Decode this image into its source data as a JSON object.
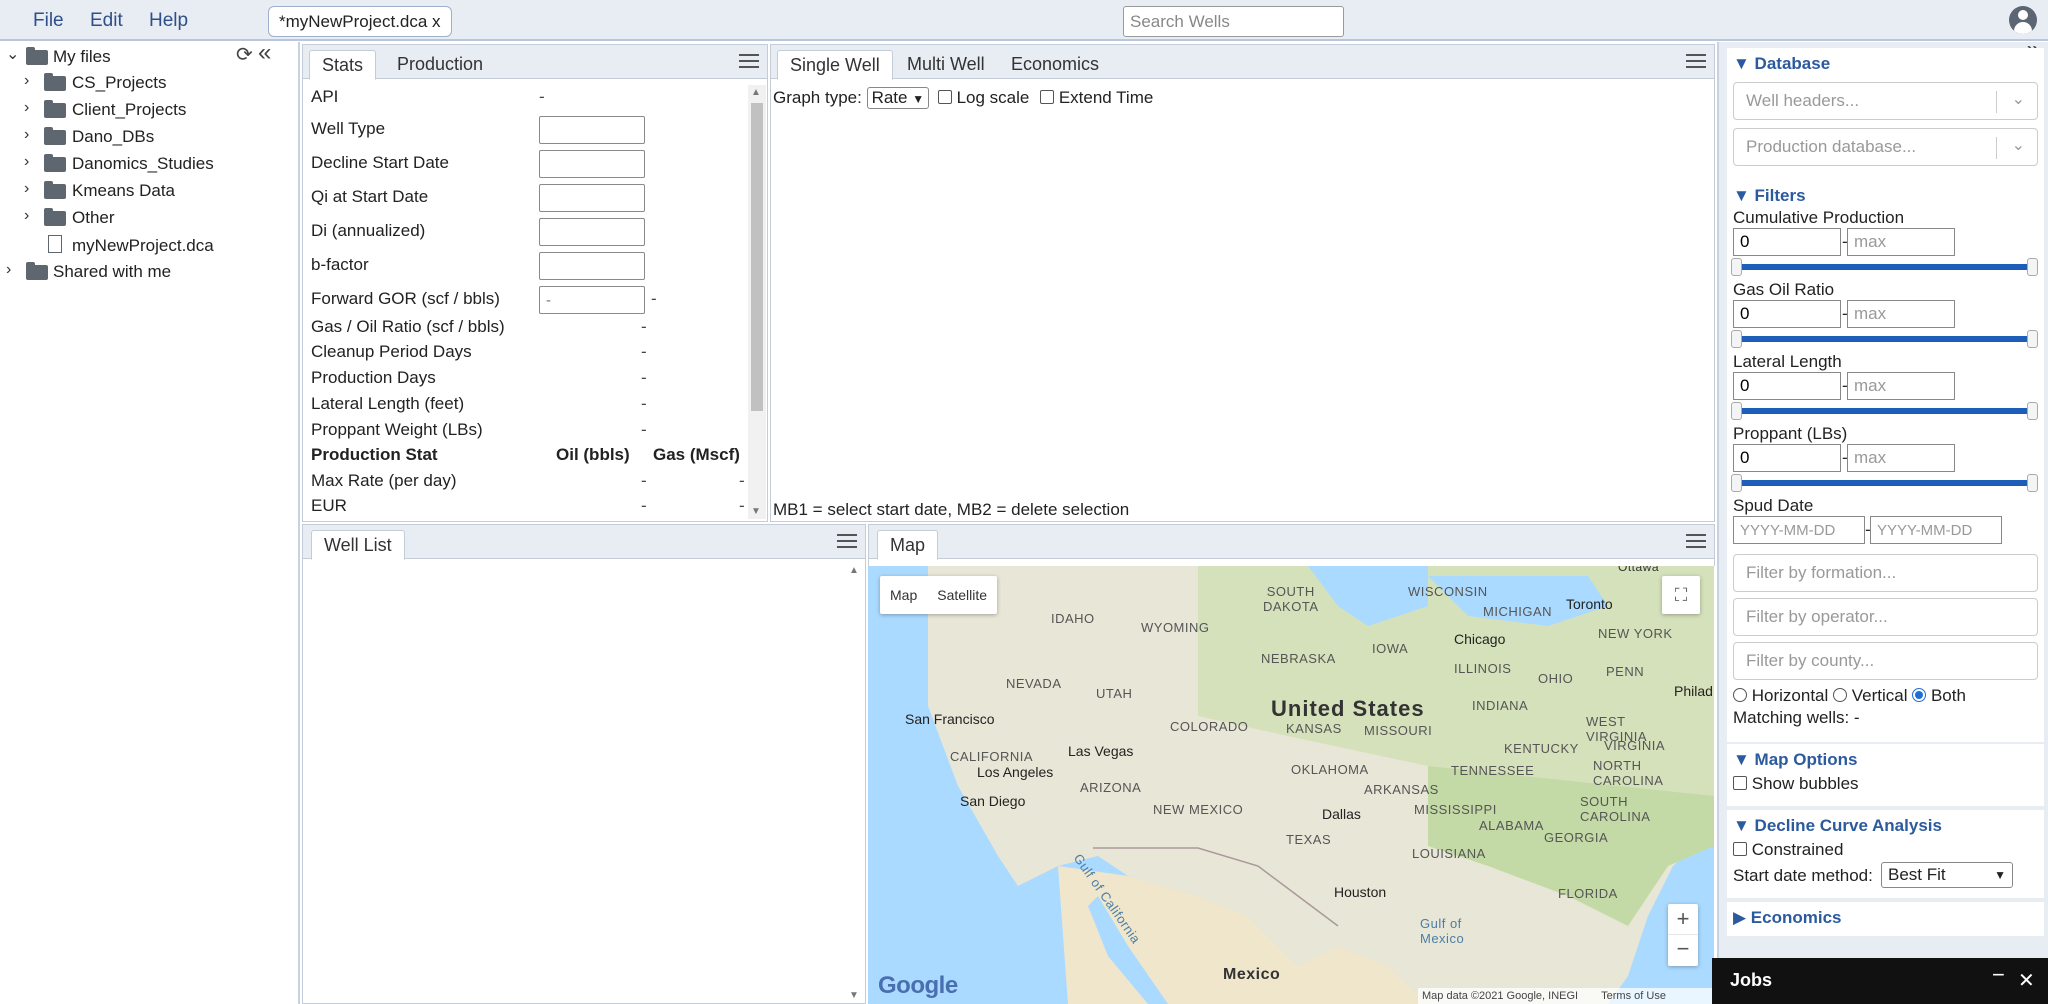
{
  "menu": {
    "file": "File",
    "edit": "Edit",
    "help": "Help"
  },
  "open_tab": "*myNewProject.dca x",
  "search": {
    "placeholder": "Search Wells"
  },
  "filetree": {
    "items": [
      {
        "label": "My files",
        "type": "folder",
        "expanded": true
      },
      {
        "label": "CS_Projects",
        "type": "folder"
      },
      {
        "label": "Client_Projects",
        "type": "folder"
      },
      {
        "label": "Dano_DBs",
        "type": "folder"
      },
      {
        "label": "Danomics_Studies",
        "type": "folder"
      },
      {
        "label": "Kmeans Data",
        "type": "folder"
      },
      {
        "label": "Other",
        "type": "folder"
      },
      {
        "label": "myNewProject.dca",
        "type": "file"
      },
      {
        "label": "Shared with me",
        "type": "folder"
      }
    ]
  },
  "stats_panel": {
    "tabs": [
      "Stats",
      "Production"
    ],
    "rows": [
      {
        "label": "API",
        "value": "-"
      },
      {
        "label": "Well Type",
        "input": ""
      },
      {
        "label": "Decline Start Date",
        "input": ""
      },
      {
        "label": "Qi at Start Date",
        "input": ""
      },
      {
        "label": "Di (annualized)",
        "input": ""
      },
      {
        "label": "b-factor",
        "input": ""
      },
      {
        "label": "Forward GOR (scf / bbls)",
        "input_placeholder": "-",
        "value": "-"
      },
      {
        "label": "Gas / Oil Ratio (scf / bbls)",
        "value": "-"
      },
      {
        "label": "Cleanup Period Days",
        "value": "-"
      },
      {
        "label": "Production Days",
        "value": "-"
      },
      {
        "label": "Lateral Length (feet)",
        "value": "-"
      },
      {
        "label": "Proppant Weight (LBs)",
        "value": "-"
      }
    ],
    "prod_header": {
      "label": "Production Stat",
      "oil": "Oil (bbls)",
      "gas": "Gas (Mscf)"
    },
    "prod_rows": [
      {
        "label": "Max Rate (per day)",
        "oil": "-",
        "gas": "-"
      },
      {
        "label": "EUR",
        "oil": "-",
        "gas": "-"
      }
    ]
  },
  "graph_panel": {
    "tabs": [
      "Single Well",
      "Multi Well",
      "Economics"
    ],
    "graph_type_label": "Graph type:",
    "graph_type_value": "Rate",
    "log_scale_label": "Log scale",
    "extend_time_label": "Extend Time",
    "hint": "MB1 = select start date, MB2 = delete selection"
  },
  "well_list_panel": {
    "tab": "Well List"
  },
  "map_panel": {
    "tab": "Map",
    "map_type_buttons": [
      "Map",
      "Satellite"
    ],
    "zoom_in": "+",
    "zoom_out": "−",
    "google": "Google",
    "attribution": "Map data ©2021 Google, INEGI",
    "terms": "Terms of Use",
    "country_label": "United States",
    "region_labels": {
      "south_dakota": "SOUTH\nDAKOTA",
      "wisconsin": "WISCONSIN",
      "michigan": "MICHIGAN",
      "idaho": "IDAHO",
      "wyoming": "WYOMING",
      "nebraska": "NEBRASKA",
      "iowa": "IOWA",
      "new_york": "NEW YORK",
      "illinois": "ILLINOIS",
      "ohio": "OHIO",
      "penn": "PENN",
      "nevada": "NEVADA",
      "utah": "UTAH",
      "colorado": "COLORADO",
      "kansas": "KANSAS",
      "missouri": "MISSOURI",
      "indiana": "INDIANA",
      "west_virginia": "WEST\nVIRGINIA",
      "virginia": "VIRGINIA",
      "kentucky": "KENTUCKY",
      "california": "CALIFORNIA",
      "arizona": "ARIZONA",
      "new_mexico": "NEW MEXICO",
      "oklahoma": "OKLAHOMA",
      "tennessee": "TENNESSEE",
      "north_carolina": "NORTH\nCAROLINA",
      "arkansas": "ARKANSAS",
      "south_carolina": "SOUTH\nCAROLINA",
      "mississippi": "MISSISSIPPI",
      "alabama": "ALABAMA",
      "georgia": "GEORGIA",
      "texas": "TEXAS",
      "louisiana": "LOUISIANA",
      "florida": "FLORIDA",
      "gulf_california": "Gulf of California",
      "gulf_mexico": "Gulf of\nMexico",
      "mexico": "Mexico",
      "ottawa": "Ottawa"
    },
    "cities": {
      "toronto": "Toronto",
      "chicago": "Chicago",
      "philadelphia": "Philad",
      "san_francisco": "San Francisco",
      "las_vegas": "Las Vegas",
      "los_angeles": "Los Angeles",
      "san_diego": "San Diego",
      "dallas": "Dallas",
      "houston": "Houston"
    }
  },
  "sidebar": {
    "database": {
      "title": "▼ Database",
      "well_headers_placeholder": "Well headers...",
      "production_placeholder": "Production database..."
    },
    "filters": {
      "title": "▼ Filters",
      "ranges": [
        {
          "label": "Cumulative Production",
          "min": "0",
          "max_placeholder": "max"
        },
        {
          "label": "Gas Oil Ratio",
          "min": "0",
          "max_placeholder": "max"
        },
        {
          "label": "Lateral Length",
          "min": "0",
          "max_placeholder": "max"
        },
        {
          "label": "Proppant (LBs)",
          "min": "0",
          "max_placeholder": "max"
        }
      ],
      "spud_label": "Spud Date",
      "spud_from_placeholder": "YYYY-MM-DD",
      "spud_to_placeholder": "YYYY-MM-DD",
      "formation_placeholder": "Filter by formation...",
      "operator_placeholder": "Filter by operator...",
      "county_placeholder": "Filter by county...",
      "orientation": {
        "horizontal": "Horizontal",
        "vertical": "Vertical",
        "both": "Both",
        "selected": "Both"
      },
      "matching": "Matching wells: -"
    },
    "map_options": {
      "title": "▼ Map Options",
      "show_bubbles": "Show bubbles"
    },
    "dca": {
      "title": "▼ Decline Curve Analysis",
      "constrained": "Constrained",
      "start_method_label": "Start date method:",
      "start_method_value": "Best Fit"
    },
    "economics": {
      "title": "▶ Economics"
    }
  },
  "jobs": {
    "title": "Jobs",
    "minimize": "−",
    "close": "✕"
  },
  "colors": {
    "accent": "#2b5a9e",
    "slider": "#1d5fb8",
    "topbar": "#e8ecf3"
  }
}
